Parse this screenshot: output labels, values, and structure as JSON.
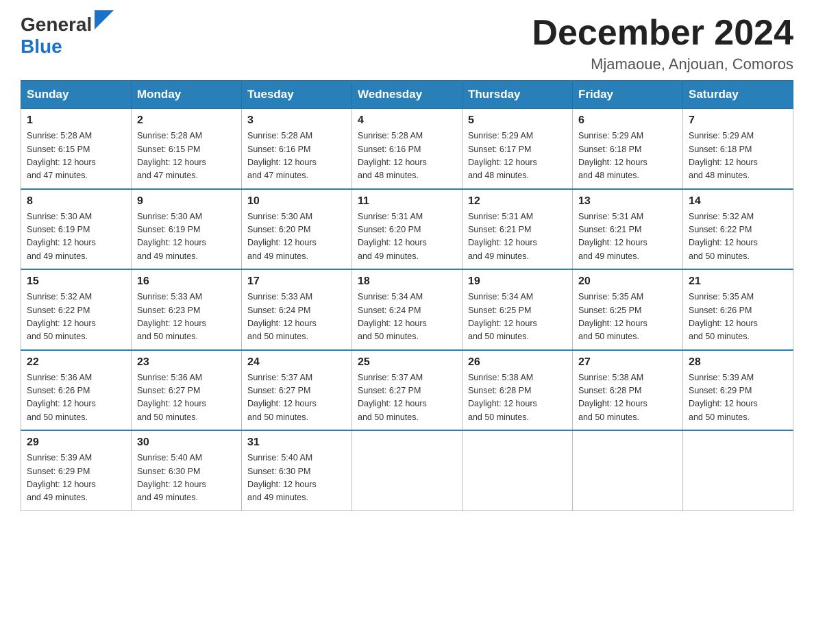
{
  "header": {
    "logo_general": "General",
    "logo_blue": "Blue",
    "title": "December 2024",
    "subtitle": "Mjamaoue, Anjouan, Comoros"
  },
  "days_of_week": [
    "Sunday",
    "Monday",
    "Tuesday",
    "Wednesday",
    "Thursday",
    "Friday",
    "Saturday"
  ],
  "weeks": [
    [
      {
        "day": "1",
        "sunrise": "5:28 AM",
        "sunset": "6:15 PM",
        "daylight": "12 hours and 47 minutes."
      },
      {
        "day": "2",
        "sunrise": "5:28 AM",
        "sunset": "6:15 PM",
        "daylight": "12 hours and 47 minutes."
      },
      {
        "day": "3",
        "sunrise": "5:28 AM",
        "sunset": "6:16 PM",
        "daylight": "12 hours and 47 minutes."
      },
      {
        "day": "4",
        "sunrise": "5:28 AM",
        "sunset": "6:16 PM",
        "daylight": "12 hours and 48 minutes."
      },
      {
        "day": "5",
        "sunrise": "5:29 AM",
        "sunset": "6:17 PM",
        "daylight": "12 hours and 48 minutes."
      },
      {
        "day": "6",
        "sunrise": "5:29 AM",
        "sunset": "6:18 PM",
        "daylight": "12 hours and 48 minutes."
      },
      {
        "day": "7",
        "sunrise": "5:29 AM",
        "sunset": "6:18 PM",
        "daylight": "12 hours and 48 minutes."
      }
    ],
    [
      {
        "day": "8",
        "sunrise": "5:30 AM",
        "sunset": "6:19 PM",
        "daylight": "12 hours and 49 minutes."
      },
      {
        "day": "9",
        "sunrise": "5:30 AM",
        "sunset": "6:19 PM",
        "daylight": "12 hours and 49 minutes."
      },
      {
        "day": "10",
        "sunrise": "5:30 AM",
        "sunset": "6:20 PM",
        "daylight": "12 hours and 49 minutes."
      },
      {
        "day": "11",
        "sunrise": "5:31 AM",
        "sunset": "6:20 PM",
        "daylight": "12 hours and 49 minutes."
      },
      {
        "day": "12",
        "sunrise": "5:31 AM",
        "sunset": "6:21 PM",
        "daylight": "12 hours and 49 minutes."
      },
      {
        "day": "13",
        "sunrise": "5:31 AM",
        "sunset": "6:21 PM",
        "daylight": "12 hours and 49 minutes."
      },
      {
        "day": "14",
        "sunrise": "5:32 AM",
        "sunset": "6:22 PM",
        "daylight": "12 hours and 50 minutes."
      }
    ],
    [
      {
        "day": "15",
        "sunrise": "5:32 AM",
        "sunset": "6:22 PM",
        "daylight": "12 hours and 50 minutes."
      },
      {
        "day": "16",
        "sunrise": "5:33 AM",
        "sunset": "6:23 PM",
        "daylight": "12 hours and 50 minutes."
      },
      {
        "day": "17",
        "sunrise": "5:33 AM",
        "sunset": "6:24 PM",
        "daylight": "12 hours and 50 minutes."
      },
      {
        "day": "18",
        "sunrise": "5:34 AM",
        "sunset": "6:24 PM",
        "daylight": "12 hours and 50 minutes."
      },
      {
        "day": "19",
        "sunrise": "5:34 AM",
        "sunset": "6:25 PM",
        "daylight": "12 hours and 50 minutes."
      },
      {
        "day": "20",
        "sunrise": "5:35 AM",
        "sunset": "6:25 PM",
        "daylight": "12 hours and 50 minutes."
      },
      {
        "day": "21",
        "sunrise": "5:35 AM",
        "sunset": "6:26 PM",
        "daylight": "12 hours and 50 minutes."
      }
    ],
    [
      {
        "day": "22",
        "sunrise": "5:36 AM",
        "sunset": "6:26 PM",
        "daylight": "12 hours and 50 minutes."
      },
      {
        "day": "23",
        "sunrise": "5:36 AM",
        "sunset": "6:27 PM",
        "daylight": "12 hours and 50 minutes."
      },
      {
        "day": "24",
        "sunrise": "5:37 AM",
        "sunset": "6:27 PM",
        "daylight": "12 hours and 50 minutes."
      },
      {
        "day": "25",
        "sunrise": "5:37 AM",
        "sunset": "6:27 PM",
        "daylight": "12 hours and 50 minutes."
      },
      {
        "day": "26",
        "sunrise": "5:38 AM",
        "sunset": "6:28 PM",
        "daylight": "12 hours and 50 minutes."
      },
      {
        "day": "27",
        "sunrise": "5:38 AM",
        "sunset": "6:28 PM",
        "daylight": "12 hours and 50 minutes."
      },
      {
        "day": "28",
        "sunrise": "5:39 AM",
        "sunset": "6:29 PM",
        "daylight": "12 hours and 50 minutes."
      }
    ],
    [
      {
        "day": "29",
        "sunrise": "5:39 AM",
        "sunset": "6:29 PM",
        "daylight": "12 hours and 49 minutes."
      },
      {
        "day": "30",
        "sunrise": "5:40 AM",
        "sunset": "6:30 PM",
        "daylight": "12 hours and 49 minutes."
      },
      {
        "day": "31",
        "sunrise": "5:40 AM",
        "sunset": "6:30 PM",
        "daylight": "12 hours and 49 minutes."
      },
      null,
      null,
      null,
      null
    ]
  ],
  "labels": {
    "sunrise": "Sunrise:",
    "sunset": "Sunset:",
    "daylight": "Daylight:"
  }
}
